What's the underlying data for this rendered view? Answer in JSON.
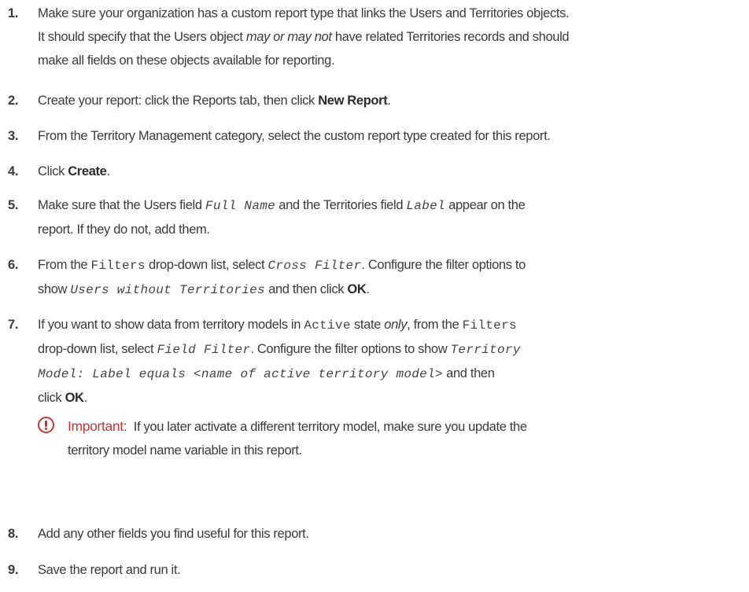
{
  "steps": [
    {
      "num": "1.",
      "l1": "Make sure your organization has a custom report type that links the Users and Territories objects.",
      "l2a": "It should specify that the Users object ",
      "l2em": "may or may not",
      "l2b": " have related Territories records and should",
      "l3": "make all fields on these objects available for reporting."
    },
    {
      "num": "2.",
      "a": "Create your report: click the Reports tab, then click ",
      "bold": "New Report",
      "b": "."
    },
    {
      "num": "3.",
      "text": "From the Territory Management category, select the custom report type created for this report."
    },
    {
      "num": "4.",
      "a": "Click ",
      "bold": "Create",
      "b": "."
    },
    {
      "num": "5.",
      "a": "Make sure that the Users field ",
      "code1": "Full Name",
      "b": " and the Territories field ",
      "code2": "Label",
      "c": " appear on the",
      "l2": "report. If they do not, add them."
    },
    {
      "num": "6.",
      "a": "From the ",
      "code1": "Filters",
      "b": " drop-down list, select ",
      "code2": "Cross Filter",
      "c": ". Configure the filter options to",
      "l2a": "show ",
      "code3": "Users without Territories",
      "l2b": " and then click ",
      "bold": "OK",
      "l2c": "."
    },
    {
      "num": "7.",
      "a": "If you want to show data from territory models in ",
      "code1": "Active",
      "b": " state ",
      "em": "only",
      "c": ", from the ",
      "code2": "Filters",
      "l2a": "drop-down list, select ",
      "code3": "Field Filter",
      "l2b": ". Configure the filter options to show ",
      "code4": "Territory",
      "code5": "Model: Label equals <name of active territory model>",
      "l3b": " and then",
      "l4a": "click ",
      "bold": "OK",
      "l4b": "."
    },
    {
      "num": "8.",
      "text": "Add any other fields you find useful for this report."
    },
    {
      "num": "9.",
      "text": "Save the report and run it."
    }
  ],
  "note": {
    "label": "Important:",
    "l1": "If you later activate a different territory model, make sure you update the",
    "l2": "territory model name variable in this report."
  },
  "colors": {
    "text": "#3a3a3a",
    "important": "#c23934"
  }
}
